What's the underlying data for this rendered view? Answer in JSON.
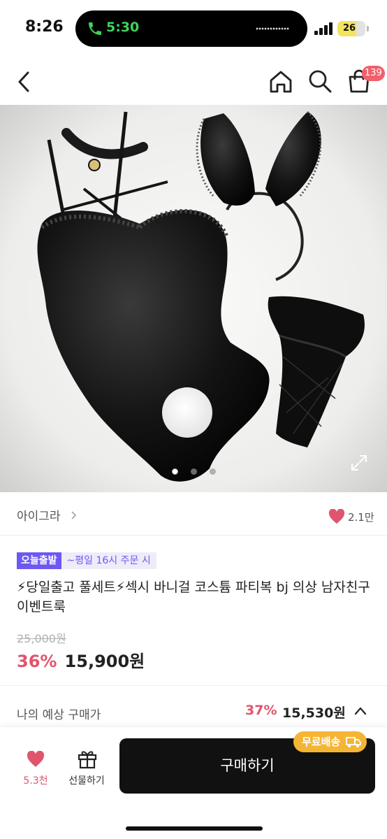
{
  "status": {
    "time": "8:26",
    "call_time": "5:30",
    "battery": "26"
  },
  "nav": {
    "cart_count": "139"
  },
  "gallery": {
    "total_images": 3,
    "active_index": 0
  },
  "seller": {
    "name": "아이그라",
    "likes": "2.1만"
  },
  "product": {
    "badge_label": "오늘출발",
    "badge_desc": "~평일 16시 주문 시",
    "title": "⚡당일출고 풀세트⚡섹시 바니걸 코스튬 파티복 bj 의상 남자친구 이벤트룩",
    "original_price": "25,000원",
    "discount": "36%",
    "price": "15,900원"
  },
  "expected": {
    "label": "나의 예상 구매가",
    "discount": "37%",
    "price": "15,530원"
  },
  "bottom": {
    "wish_count": "5.3천",
    "gift_label": "선물하기",
    "buy_label": "구매하기",
    "free_shipping": "무료배송"
  },
  "colors": {
    "accent": "#e0556e",
    "badge": "#6d58f2",
    "shipping": "#f5b534"
  }
}
